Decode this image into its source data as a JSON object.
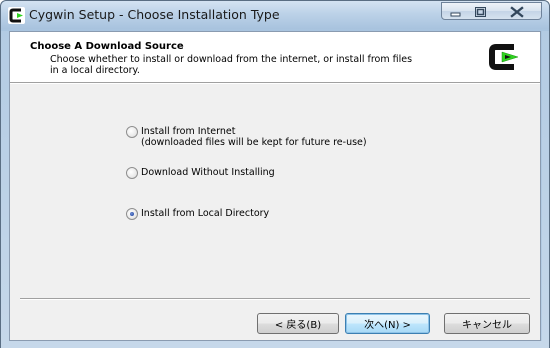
{
  "window": {
    "title": "Cygwin Setup - Choose Installation Type",
    "controls": {
      "minimize": "minimize-icon",
      "maximize": "maximize-icon",
      "close": "close-icon"
    }
  },
  "header": {
    "title": "Choose  A Download Source",
    "description": "Choose whether to install or download from the internet, or install from files in a local directory.",
    "logo": "cygwin-logo"
  },
  "options": [
    {
      "label": "Install from Internet",
      "sublabel": "(downloaded files will be kept for future re-use)",
      "selected": false
    },
    {
      "label": "Download Without Installing",
      "sublabel": "",
      "selected": false
    },
    {
      "label": "Install from Local Directory",
      "sublabel": "",
      "selected": true
    }
  ],
  "buttons": {
    "back": "< 戻る(B)",
    "next": "次へ(N) >",
    "cancel": "キャンセル"
  },
  "colors": {
    "logo_green": "#2fd41f",
    "title_bar": "#bcd2e8",
    "dialog_bg": "#f0f0f0"
  }
}
